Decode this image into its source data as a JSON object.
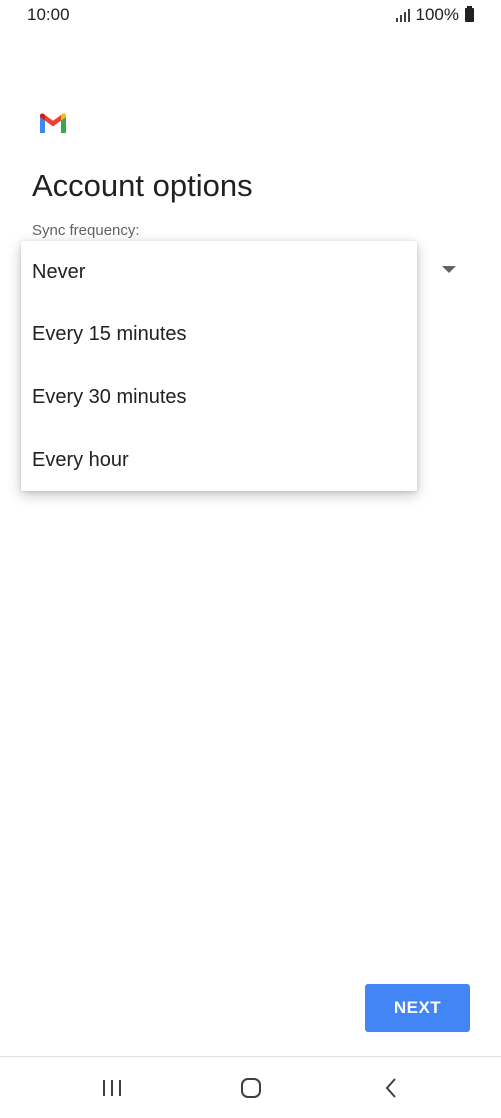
{
  "status_bar": {
    "time": "10:00",
    "battery": "100%",
    "icons": [
      "signal-icon",
      "battery-icon"
    ]
  },
  "app": {
    "logo": "gmail-logo",
    "brand_colors": {
      "blue": "#4285f4",
      "red": "#ea4335",
      "yellow": "#fbbc04",
      "green": "#34a853"
    }
  },
  "page": {
    "title": "Account options",
    "sync_label": "Sync frequency:"
  },
  "sync_dropdown": {
    "options": [
      "Never",
      "Every 15 minutes",
      "Every 30 minutes",
      "Every hour"
    ]
  },
  "footer": {
    "next_label": "NEXT",
    "next_color": "#4285f4"
  },
  "nav_bar": {
    "icons": [
      "recents-icon",
      "home-icon",
      "back-icon"
    ]
  }
}
